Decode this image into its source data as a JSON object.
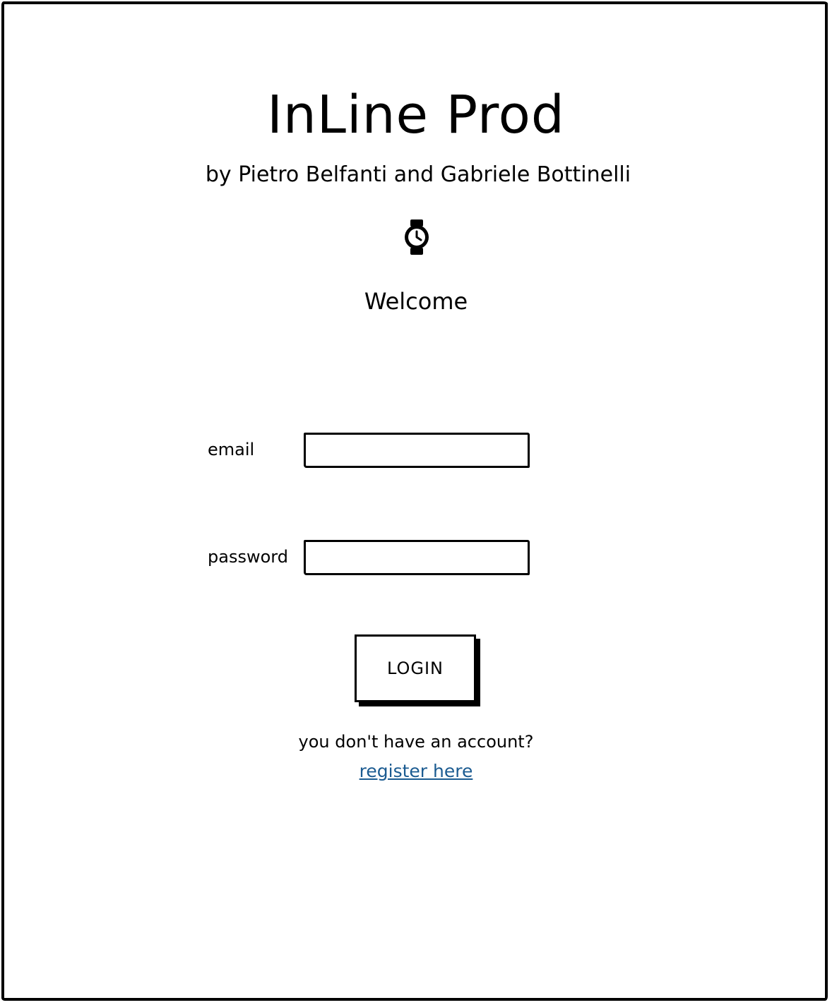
{
  "app": {
    "title": "InLine Prod",
    "subtitle": "by Pietro Belfanti and Gabriele Bottinelli",
    "logo_icon": "watch-icon",
    "welcome": "Welcome"
  },
  "login_form": {
    "email_label": "email",
    "email_value": "",
    "password_label": "password",
    "password_value": "",
    "login_button_label": "LOGIN"
  },
  "footer": {
    "account_question": "you don't have an account?",
    "register_link_text": "register here",
    "link_color": "#1b5b91"
  }
}
